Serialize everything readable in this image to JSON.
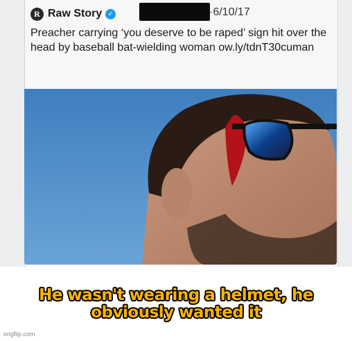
{
  "tweet": {
    "avatar_letter": "R",
    "account_name": "Raw Story",
    "date": "·6/10/17",
    "text": "Preacher carrying ‘you deserve to be raped’ sign hit over the head by baseball bat-wielding woman ow.ly/tdnT30cuman"
  },
  "caption": {
    "line1": "He wasn't wearing a helmet, he",
    "line2": "obviously wanted it"
  },
  "watermark": "imgflip.com",
  "colors": {
    "caption_fill": "#ffb400",
    "verified": "#1d9bf0",
    "sky": "#4a86c4"
  }
}
